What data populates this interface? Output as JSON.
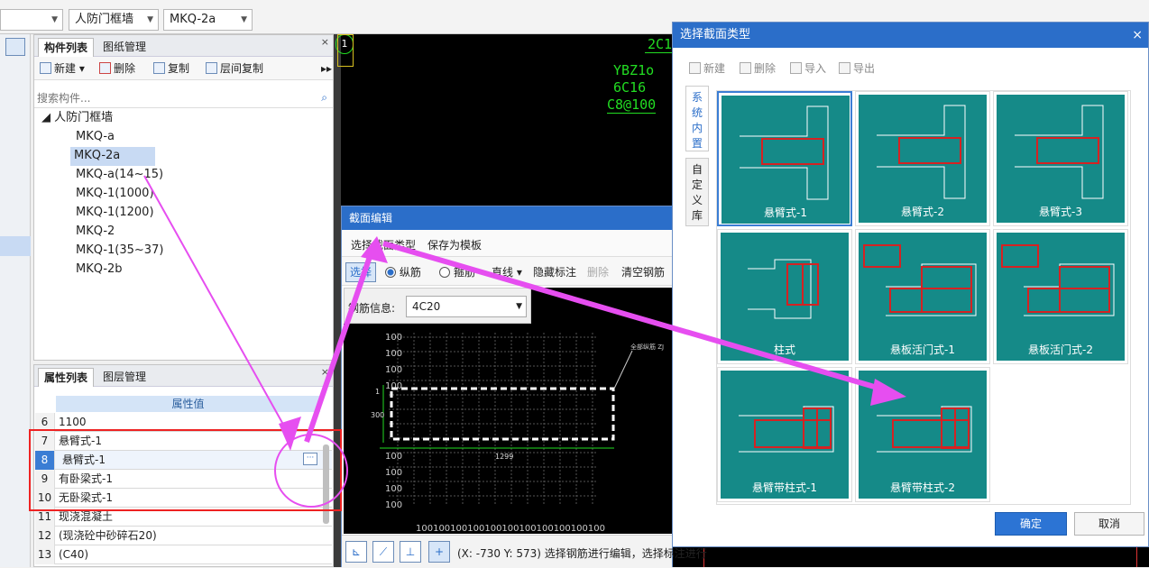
{
  "top": {
    "combo1": "",
    "combo2": "人防门框墙",
    "combo3": "MKQ-2a"
  },
  "component_panel": {
    "tabs": [
      "构件列表",
      "图纸管理"
    ],
    "toolbar": {
      "new": "新建",
      "delete": "删除",
      "copy": "复制",
      "floor_copy": "层间复制"
    },
    "search_placeholder": "搜索构件...",
    "root": "人防门框墙",
    "items": [
      "MKQ-a",
      "MKQ-2a",
      "MKQ-a(14~15)",
      "MKQ-1(1000)",
      "MKQ-1(1200)",
      "MKQ-2",
      "MKQ-1(35~37)",
      "MKQ-2b"
    ],
    "selected": "MKQ-2a"
  },
  "property_panel": {
    "tabs": [
      "属性列表",
      "图层管理"
    ],
    "header": "属性值",
    "rows": [
      {
        "num": "6",
        "value": "1100"
      },
      {
        "num": "7",
        "value": "悬臂式-1"
      },
      {
        "num": "8",
        "value": "悬臂式-1"
      },
      {
        "num": "9",
        "value": "有卧梁式-1"
      },
      {
        "num": "10",
        "value": "无卧梁式-1"
      },
      {
        "num": "11",
        "value": "现浇混凝土"
      },
      {
        "num": "12",
        "value": "(现浇砼中砂碎石20)"
      },
      {
        "num": "13",
        "value": "(C40)"
      }
    ],
    "more_button": "···"
  },
  "cad": {
    "label_2c": "2C1",
    "label1": "YBZ1o",
    "label2": "6C16",
    "label3": "C8@100",
    "marker": "1"
  },
  "section_editor": {
    "title": "截面编辑",
    "menu": [
      "选择截面类型",
      "保存为模板"
    ],
    "tools": {
      "select": "选择",
      "radio_long": "纵筋",
      "radio_stirrup": "箍筋",
      "line": "直线",
      "hide_mark": "隐藏标注",
      "delete": "删除",
      "clear": "清空钢筋"
    },
    "rebar_info_label": "钢筋信息:",
    "rebar_info_value": "4C20",
    "dim_label": "全部纵筋 ZJ",
    "grid_nums": [
      "100",
      "100",
      "100",
      "100",
      "100",
      "100",
      "100",
      "100"
    ],
    "bottom_nums": "100100100100100100100100100100100",
    "side_left": "1",
    "side_300": "300",
    "width_label": "1299",
    "status": "(X: -730 Y: 573)  选择钢筋进行编辑，选择标注进行"
  },
  "dialog": {
    "title": "选择截面类型",
    "toolbar": {
      "new": "新建",
      "delete": "删除",
      "import": "导入",
      "export": "导出"
    },
    "side_tabs": [
      "系统内置",
      "自定义库"
    ],
    "cards": [
      "悬臂式-1",
      "悬臂式-2",
      "悬臂式-3",
      "柱式",
      "悬板活门式-1",
      "悬板活门式-2",
      "悬臂带柱式-1",
      "悬臂带柱式-2"
    ],
    "ok": "确定",
    "cancel": "取消",
    "close": "×"
  },
  "colors": {
    "accent": "#2b6ec9",
    "teal": "#158a88",
    "arrow": "#e64ef0",
    "highlight": "#ee2222",
    "cad_green": "#22dd22"
  }
}
